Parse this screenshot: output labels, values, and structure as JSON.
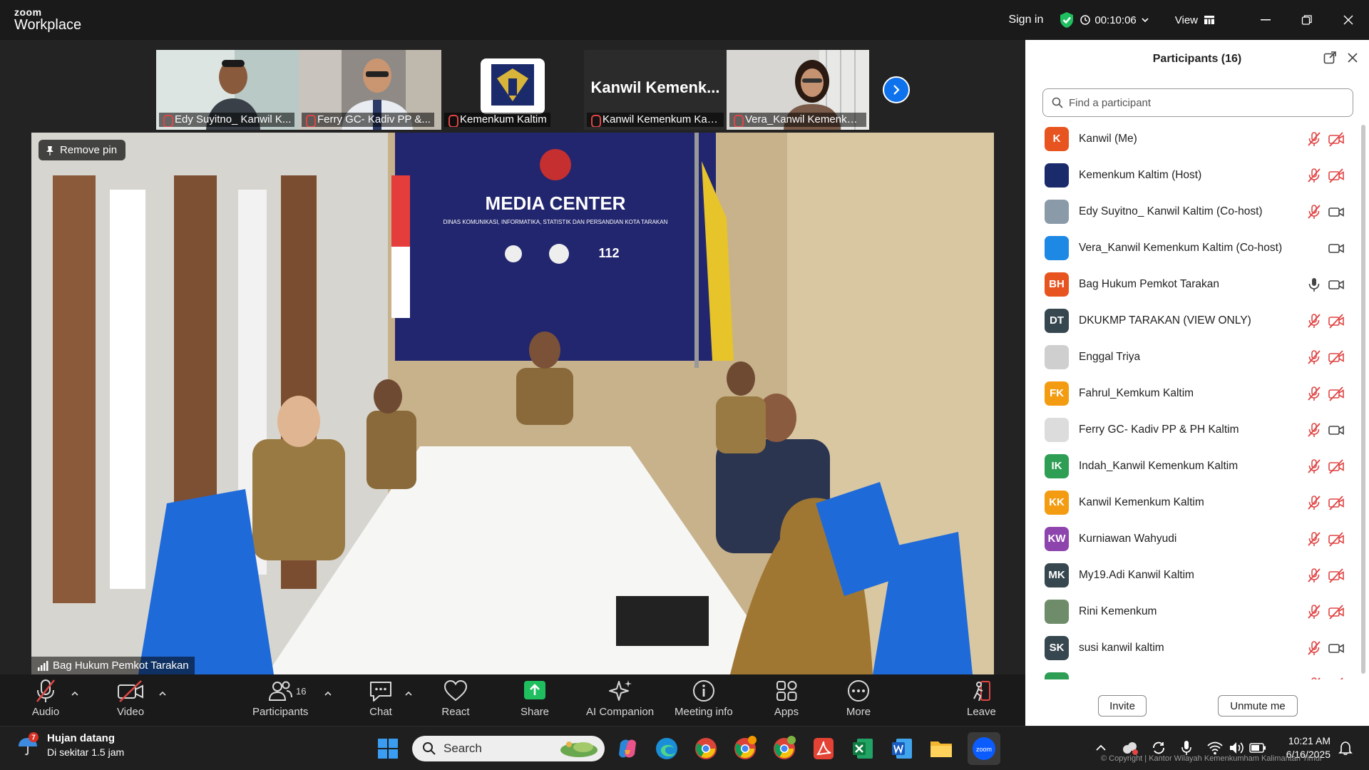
{
  "app": {
    "brand_top": "zoom",
    "brand_bottom": "Workplace"
  },
  "titlebar": {
    "signin": "Sign in",
    "timer": "00:10:06",
    "view": "View"
  },
  "strip": {
    "tiles": [
      {
        "label": "Edy Suyitno_ Kanwil K..."
      },
      {
        "label": "Ferry GC- Kadiv PP &..."
      },
      {
        "label": "Kemenkum Kaltim"
      },
      {
        "label": "Kanwil Kemenkum Kalt...",
        "big_name": "Kanwil  Kemenk..."
      },
      {
        "label": "Vera_Kanwil Kemenkum K..."
      }
    ]
  },
  "video": {
    "remove_pin": "Remove pin",
    "speaker": "Bag Hukum Pemkot Tarakan",
    "backdrop_title": "MEDIA CENTER",
    "backdrop_sub": "DINAS KOMUNIKASI, INFORMATIKA, STATISTIK DAN PERSANDIAN KOTA TARAKAN",
    "backdrop_badge": "112"
  },
  "toolbar": {
    "audio": "Audio",
    "video": "Video",
    "participants": "Participants",
    "participants_count": "16",
    "chat": "Chat",
    "react": "React",
    "share": "Share",
    "ai": "AI Companion",
    "info": "Meeting info",
    "apps": "Apps",
    "more": "More",
    "leave": "Leave"
  },
  "panel": {
    "title": "Participants (16)",
    "search_placeholder": "Find a participant",
    "invite": "Invite",
    "unmute": "Unmute me",
    "participants": [
      {
        "initials": "K",
        "name": "Kanwil (Me)",
        "color": "#e8541f",
        "mic": "muted",
        "cam": "off"
      },
      {
        "initials": "",
        "name": "Kemenkum Kaltim (Host)",
        "color": "#1b2a6b",
        "mic": "muted",
        "cam": "off"
      },
      {
        "initials": "",
        "name": "Edy Suyitno_ Kanwil Kaltim (Co-host)",
        "color": "#8a9aa8",
        "mic": "muted",
        "cam": "on"
      },
      {
        "initials": "",
        "name": "Vera_Kanwil Kemenkum Kaltim (Co-host)",
        "color": "#1e88e5",
        "mic": "none",
        "cam": "on"
      },
      {
        "initials": "BH",
        "name": "Bag Hukum Pemkot Tarakan",
        "color": "#e8541f",
        "mic": "on",
        "cam": "on"
      },
      {
        "initials": "DT",
        "name": "DKUKMP TARAKAN (VIEW ONLY)",
        "color": "#37474f",
        "mic": "muted",
        "cam": "off"
      },
      {
        "initials": "",
        "name": "Enggal Triya",
        "color": "#cfcfcf",
        "mic": "muted",
        "cam": "off"
      },
      {
        "initials": "FK",
        "name": "Fahrul_Kemkum Kaltim",
        "color": "#f39c12",
        "mic": "muted",
        "cam": "off"
      },
      {
        "initials": "",
        "name": "Ferry GC- Kadiv PP & PH Kaltim",
        "color": "#dcdcdc",
        "mic": "muted",
        "cam": "on"
      },
      {
        "initials": "IK",
        "name": "Indah_Kanwil Kemenkum Kaltim",
        "color": "#2e9e55",
        "mic": "muted",
        "cam": "off"
      },
      {
        "initials": "KK",
        "name": "Kanwil Kemenkum Kaltim",
        "color": "#f39c12",
        "mic": "muted",
        "cam": "off"
      },
      {
        "initials": "KW",
        "name": "Kurniawan Wahyudi",
        "color": "#8e44ad",
        "mic": "muted",
        "cam": "off"
      },
      {
        "initials": "MK",
        "name": "My19.Adi Kanwil Kaltim",
        "color": "#37474f",
        "mic": "muted",
        "cam": "off"
      },
      {
        "initials": "",
        "name": "Rini Kemenkum",
        "color": "#6f8c6a",
        "mic": "muted",
        "cam": "off"
      },
      {
        "initials": "SK",
        "name": "susi kanwil kaltim",
        "color": "#37474f",
        "mic": "muted",
        "cam": "on"
      },
      {
        "initials": "",
        "name": "",
        "color": "#2e9e55",
        "mic": "muted",
        "cam": "off"
      }
    ]
  },
  "taskbar": {
    "weather_badge": "7",
    "weather_title": "Hujan datang",
    "weather_sub": "Di sekitar 1.5 jam",
    "search": "Search",
    "time": "10:21 AM",
    "date": "6/16/2025",
    "copyright": "© Copyright | Kantor Wilayah Kemenkumham Kalimantan Timur"
  },
  "colors": {
    "accent": "#0e72ed",
    "share_green": "#1fbf5f",
    "muted_red": "#e04545"
  }
}
